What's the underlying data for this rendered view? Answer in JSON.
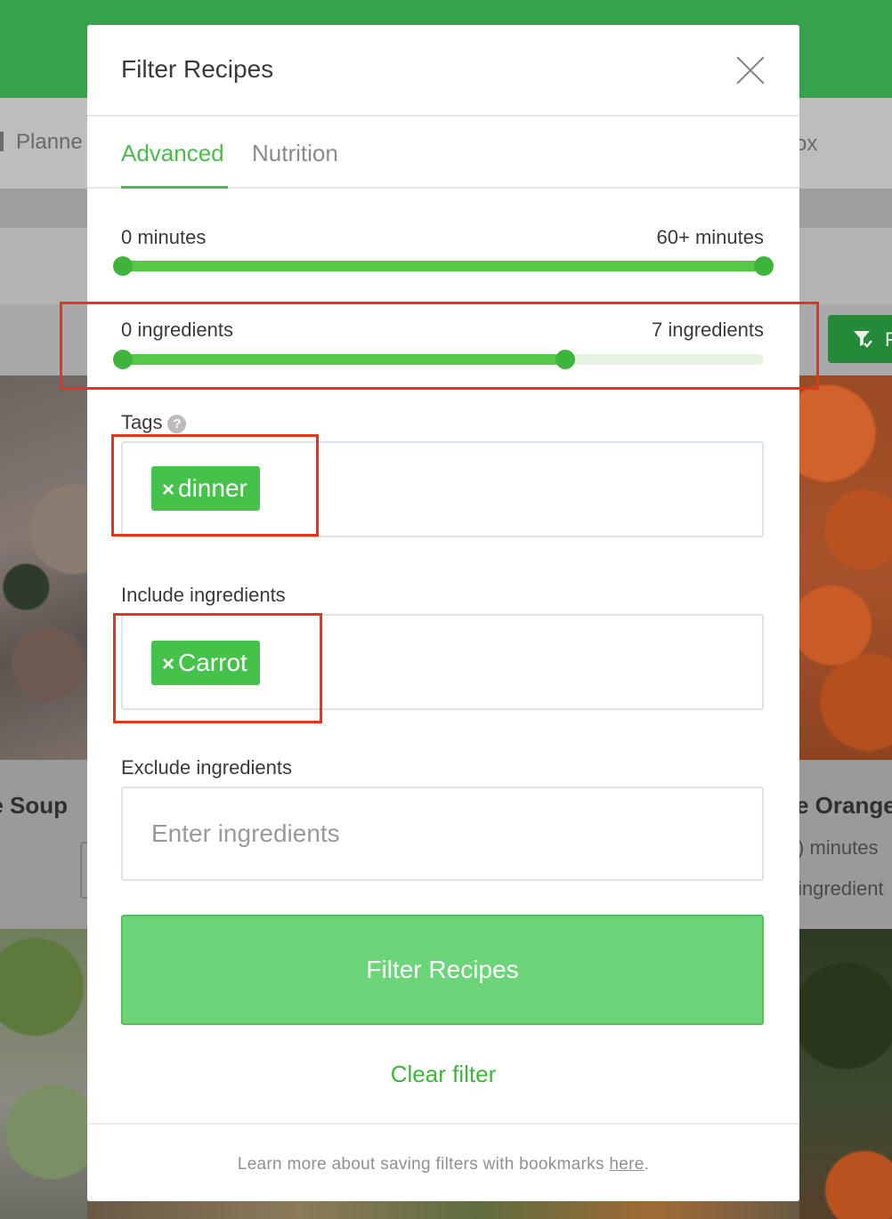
{
  "background": {
    "nav_left_label": "Planne",
    "nav_right_label": "ox",
    "filter_button_letter": "F",
    "cards": {
      "left_title": "e Soup",
      "right_title": "e Orange",
      "right_meta_time": ") minutes",
      "right_meta_ingredients": "ingredient"
    }
  },
  "modal": {
    "title": "Filter Recipes",
    "close_icon": "close-icon",
    "tabs": [
      {
        "label": "Advanced",
        "active": true
      },
      {
        "label": "Nutrition",
        "active": false
      }
    ],
    "time_range": {
      "min_label": "0 minutes",
      "max_label": "60+ minutes",
      "selected_min_fraction": 0.0,
      "selected_max_fraction": 1.0
    },
    "ingredient_range": {
      "min_label": "0 ingredients",
      "max_label": "7 ingredients",
      "selected_min_fraction": 0.0,
      "selected_max_fraction": 0.69
    },
    "tags": {
      "label": "Tags",
      "help_icon": "?",
      "chips": [
        {
          "label": "dinner"
        }
      ]
    },
    "include_ingredients": {
      "label": "Include ingredients",
      "chips": [
        {
          "label": "Carrot"
        }
      ]
    },
    "exclude_ingredients": {
      "label": "Exclude ingredients",
      "placeholder": "Enter ingredients",
      "value": ""
    },
    "primary_button": "Filter Recipes",
    "clear_link": "Clear filter",
    "footer": {
      "text": "Learn more about saving filters with bookmarks ",
      "link": "here",
      "suffix": "."
    }
  },
  "colors": {
    "brand_green": "#36a24b",
    "accent_green": "#4cbb4c",
    "chip_green": "#45c24a",
    "button_green": "#6dd579",
    "annotation_red": "#e8321c"
  }
}
